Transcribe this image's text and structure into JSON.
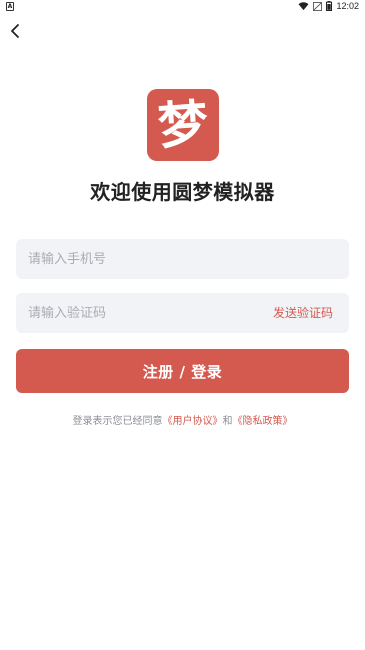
{
  "status_bar": {
    "left_icon": "A",
    "time": "12:02",
    "icons": [
      "wifi-icon",
      "signal-icon",
      "battery-icon"
    ]
  },
  "header": {
    "back_icon": "chevron-left-icon"
  },
  "logo": {
    "char": "梦",
    "color": "#d45a4f"
  },
  "title": "欢迎使用圆梦模拟器",
  "phone_input": {
    "placeholder": "请输入手机号",
    "value": ""
  },
  "code_input": {
    "placeholder": "请输入验证码",
    "value": "",
    "send_label": "发送验证码"
  },
  "submit_label": "注册 / 登录",
  "agreement": {
    "prefix": "登录表示您已经同意",
    "user_agreement": "《用户协议》",
    "conjunction": "和",
    "privacy_policy": "《隐私政策》"
  },
  "colors": {
    "accent": "#d45a4f",
    "field_bg": "#f2f3f6",
    "text": "#222222",
    "muted": "#8a8d93"
  }
}
